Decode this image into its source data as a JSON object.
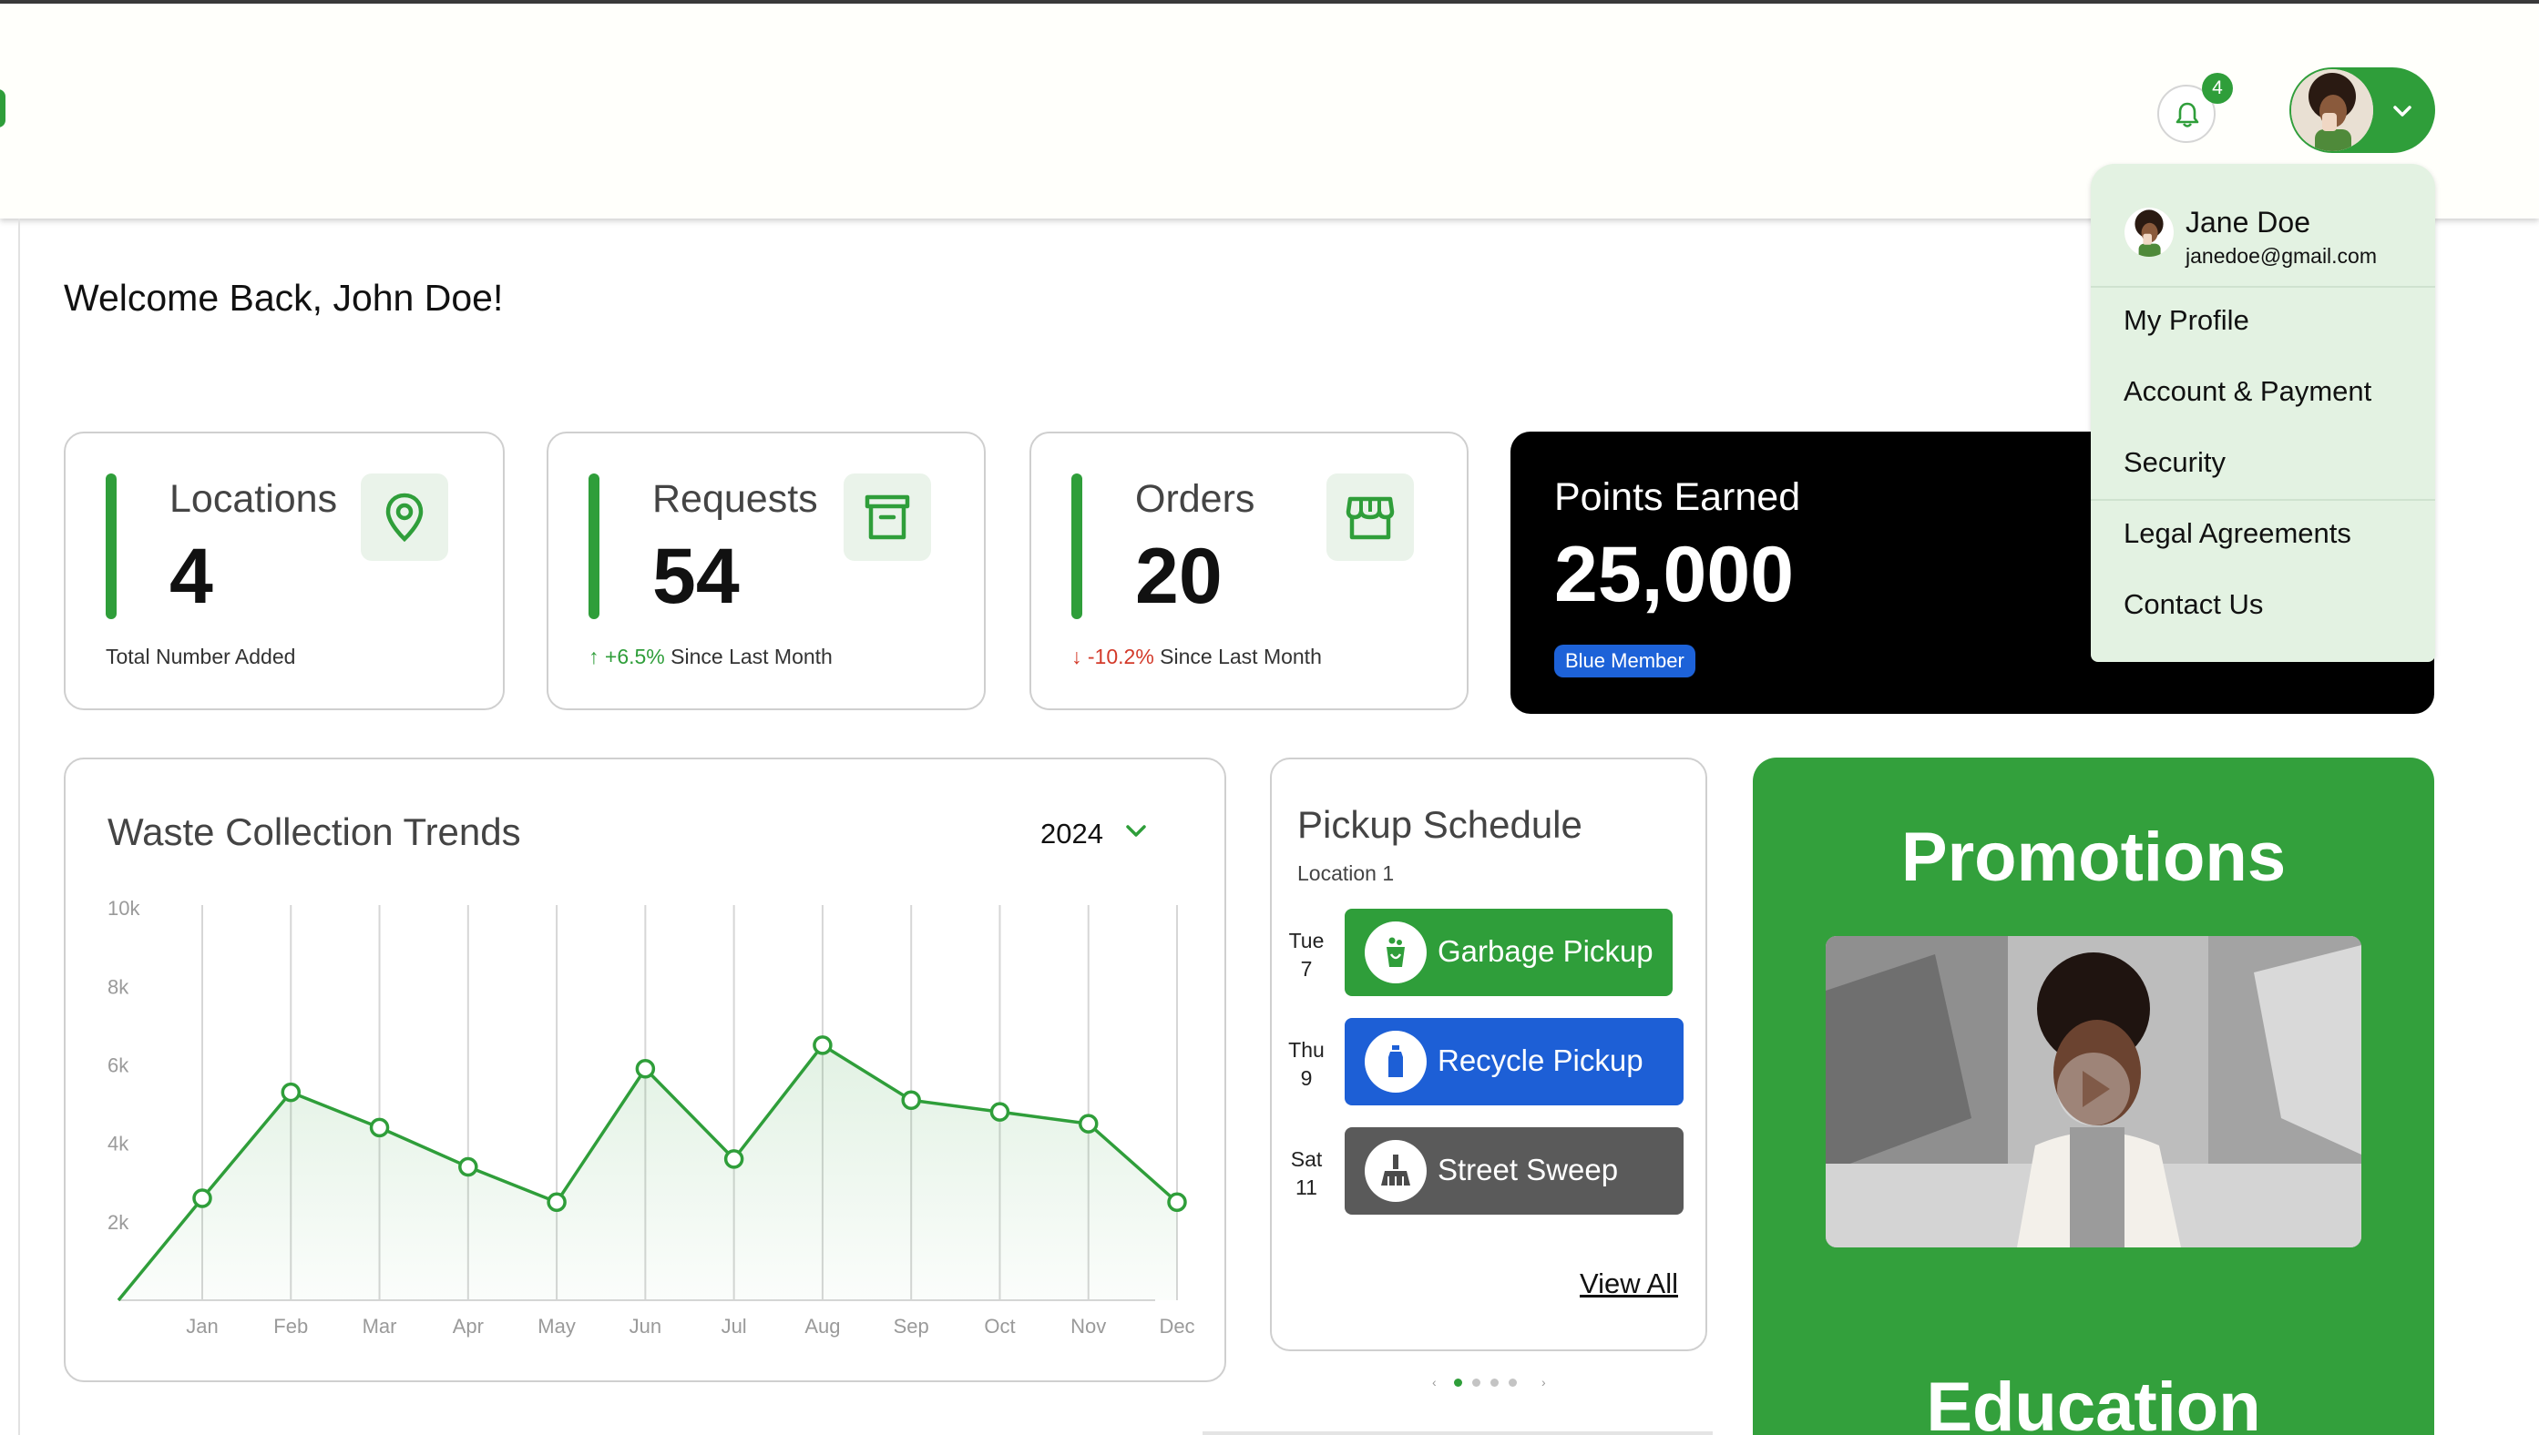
{
  "header": {
    "notifications_count": "4"
  },
  "profile_menu": {
    "name": "Jane Doe",
    "email": "janedoe@gmail.com",
    "items": [
      "My Profile",
      "Account & Payment",
      "Security",
      "Legal Agreements",
      "Contact Us"
    ]
  },
  "welcome": "Welcome Back, John Doe!",
  "stats": {
    "locations": {
      "title": "Locations",
      "value": "4",
      "footer": "Total Number Added"
    },
    "requests": {
      "title": "Requests",
      "value": "54",
      "change": "+6.5%",
      "footer": "Since Last Month"
    },
    "orders": {
      "title": "Orders",
      "value": "20",
      "change": "-10.2%",
      "footer": "Since Last Month"
    },
    "points": {
      "title": "Points Earned",
      "value": "25,000",
      "badge": "Blue Member"
    }
  },
  "trends": {
    "title": "Waste Collection Trends",
    "year": "2024"
  },
  "chart_data": {
    "type": "area",
    "title": "Waste Collection Trends",
    "categories": [
      "Jan",
      "Feb",
      "Mar",
      "Apr",
      "May",
      "Jun",
      "Jul",
      "Aug",
      "Sep",
      "Oct",
      "Nov",
      "Dec"
    ],
    "y_ticks": [
      "2k",
      "4k",
      "6k",
      "8k",
      "10k"
    ],
    "values": [
      2600,
      5300,
      4400,
      3400,
      2500,
      5900,
      3600,
      6500,
      5100,
      4800,
      4500,
      2500
    ],
    "ylim": [
      0,
      11000
    ],
    "grid": "vertical",
    "colors": {
      "line": "#2f9e3a"
    }
  },
  "schedule": {
    "title": "Pickup Schedule",
    "location": "Location 1",
    "items": [
      {
        "day": "Tue",
        "date": "7",
        "label": "Garbage Pickup",
        "color": "#2f9e3a",
        "icon": "garbage-bin-icon"
      },
      {
        "day": "Thu",
        "date": "9",
        "label": "Recycle Pickup",
        "color": "#1d5fd6",
        "icon": "bottle-icon"
      },
      {
        "day": "Sat",
        "date": "11",
        "label": "Street Sweep",
        "color": "#5a5a5a",
        "icon": "broom-icon"
      }
    ],
    "view_all": "View All"
  },
  "promotions": {
    "title": "Promotions",
    "next_title": "Education"
  },
  "colors": {
    "brand_green": "#2f9e3a",
    "blue": "#1d62d8",
    "up": "#2f9e3a",
    "down": "#d33a2a"
  }
}
